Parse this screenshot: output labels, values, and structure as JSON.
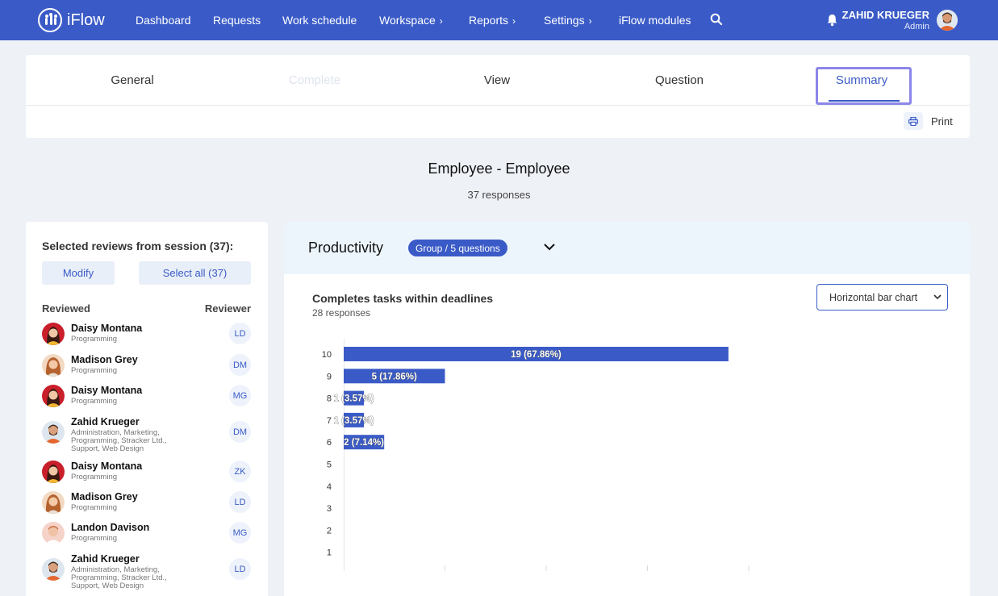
{
  "app": {
    "logo_text": "iFlow",
    "nav": [
      {
        "label": "Dashboard",
        "has_chevron": false
      },
      {
        "label": "Requests",
        "has_chevron": false
      },
      {
        "label": "Work schedule",
        "has_chevron": false
      },
      {
        "label": "Workspace",
        "has_chevron": true
      },
      {
        "label": "Reports",
        "has_chevron": true
      },
      {
        "label": "Settings",
        "has_chevron": true
      },
      {
        "label": "iFlow modules",
        "has_chevron": false
      }
    ],
    "user": {
      "name": "ZAHID KRUEGER",
      "role": "Admin"
    },
    "colors": {
      "primary": "#3a5bc7",
      "background": "#eef1f6",
      "focus_outline": "#8c86e8"
    }
  },
  "tabs": [
    {
      "label": "General",
      "state": "normal"
    },
    {
      "label": "Complete",
      "state": "disabled"
    },
    {
      "label": "View",
      "state": "normal"
    },
    {
      "label": "Question",
      "state": "normal"
    },
    {
      "label": "Summary",
      "state": "active"
    }
  ],
  "print_label": "Print",
  "survey": {
    "title": "Employee - Employee",
    "responses": "37 responses"
  },
  "left_panel": {
    "title": "Selected reviews from session (37):",
    "modify_label": "Modify",
    "select_all_label": "Select all (37)",
    "col_reviewed": "Reviewed",
    "col_reviewer": "Reviewer",
    "reviews": [
      {
        "name": "Daisy Montana",
        "dept": "Programming",
        "reviewer": "LD",
        "avatar": "woman-red"
      },
      {
        "name": "Madison Grey",
        "dept": "Programming",
        "reviewer": "DM",
        "avatar": "woman-brown"
      },
      {
        "name": "Daisy Montana",
        "dept": "Programming",
        "reviewer": "MG",
        "avatar": "woman-red"
      },
      {
        "name": "Zahid Krueger",
        "dept": "Administration, Marketing, Programming, Stracker Ltd., Support, Web Design",
        "reviewer": "DM",
        "avatar": "man-beard"
      },
      {
        "name": "Daisy Montana",
        "dept": "Programming",
        "reviewer": "ZK",
        "avatar": "woman-red"
      },
      {
        "name": "Madison Grey",
        "dept": "Programming",
        "reviewer": "LD",
        "avatar": "woman-brown"
      },
      {
        "name": "Landon Davison",
        "dept": "Programming",
        "reviewer": "MG",
        "avatar": "man-light"
      },
      {
        "name": "Zahid Krueger",
        "dept": "Administration, Marketing, Programming, Stracker Ltd., Support, Web Design",
        "reviewer": "LD",
        "avatar": "man-beard"
      }
    ]
  },
  "section": {
    "title": "Productivity",
    "badge": "Group / 5 questions",
    "question_title": "Completes tasks within deadlines",
    "question_responses": "28 responses",
    "chart_type_selected": "Horizontal bar chart"
  },
  "chart_data": {
    "type": "bar",
    "orientation": "horizontal",
    "categories": [
      "10",
      "9",
      "8",
      "7",
      "6",
      "5",
      "4",
      "3",
      "2",
      "1"
    ],
    "values": [
      19,
      5,
      1,
      1,
      2,
      0,
      0,
      0,
      0,
      0
    ],
    "labels": [
      "19 (67.86%)",
      "5 (17.86%)",
      "1 (3.57%)",
      "1 (3.57%)",
      "2 (7.14%)",
      "",
      "",
      "",
      "",
      ""
    ],
    "xlim": [
      0,
      20
    ],
    "bar_color": "#3a5bc7",
    "grid": false
  }
}
